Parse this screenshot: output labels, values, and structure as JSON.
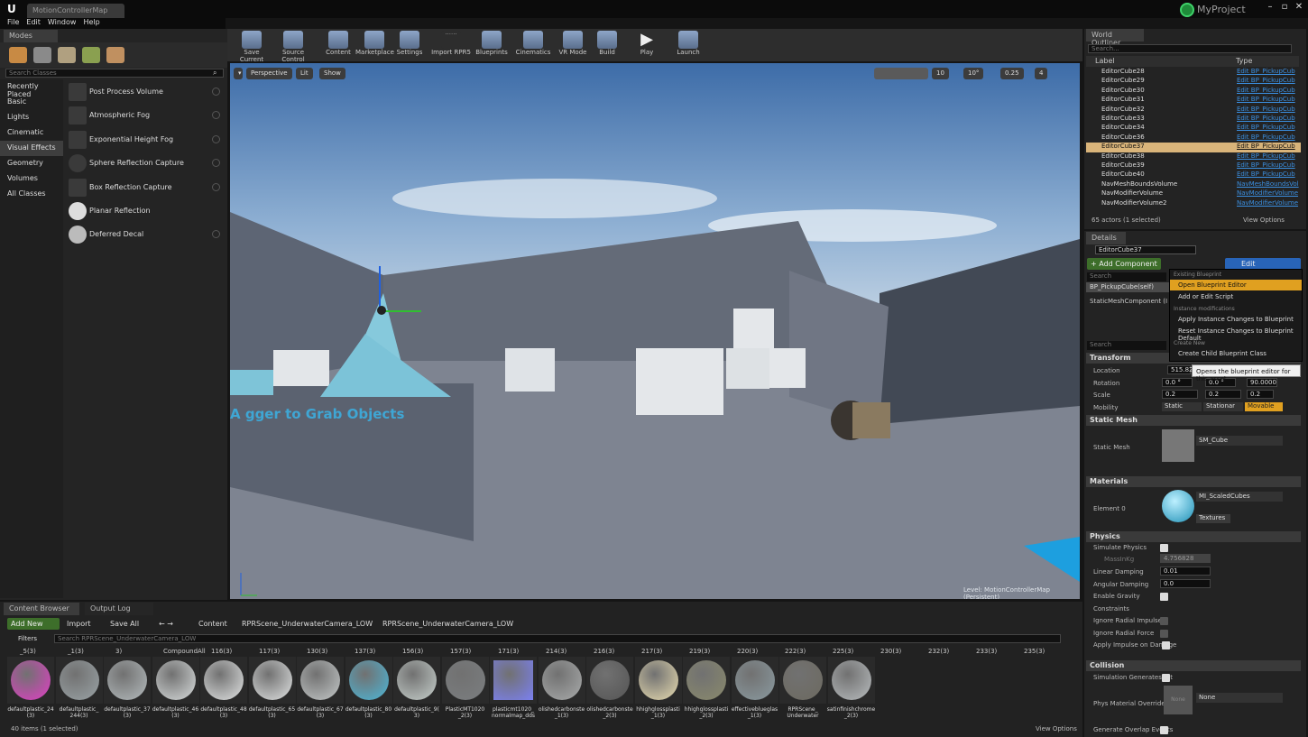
{
  "window": {
    "doc_tab": "MotionControllerMap",
    "project": "MyProject",
    "minimize": "–",
    "restore": "▫",
    "close": "✕"
  },
  "menu": [
    "File",
    "Edit",
    "Window",
    "Help"
  ],
  "modes": {
    "tab": "Modes",
    "search_placeholder": "Search Classes",
    "categories": [
      "Recently Placed",
      "Basic",
      "Lights",
      "Cinematic",
      "Visual Effects",
      "Geometry",
      "Volumes",
      "All Classes"
    ],
    "selected_category": "Visual Effects",
    "items": [
      "Post Process Volume",
      "Atmospheric Fog",
      "Exponential Height Fog",
      "Sphere Reflection Capture",
      "Box Reflection Capture",
      "Planar Reflection",
      "Deferred Decal"
    ]
  },
  "toolbar": [
    "Save Current",
    "Source Control",
    "Content",
    "Marketplace",
    "Settings",
    "Import RPR5",
    "Blueprints",
    "Cinematics",
    "VR Mode",
    "Build",
    "Play",
    "Launch"
  ],
  "viewport": {
    "perspective": "Perspective",
    "lit": "Lit",
    "show": "Show",
    "snap_grid": "10",
    "snap_rot": "10°",
    "snap_scale": "0.25",
    "cam_speed": "4",
    "in_world_text": "A  gger to Grab Objects",
    "level_label": "Level: MotionControllerMap (Persistent)"
  },
  "outliner": {
    "tab": "World Outliner",
    "search_placeholder": "Search...",
    "col_label": "Label",
    "col_type": "Type",
    "rows": [
      {
        "name": "EditorCube28",
        "type": "Edit BP_PickupCub"
      },
      {
        "name": "EditorCube29",
        "type": "Edit BP_PickupCub"
      },
      {
        "name": "EditorCube30",
        "type": "Edit BP_PickupCub"
      },
      {
        "name": "EditorCube31",
        "type": "Edit BP_PickupCub"
      },
      {
        "name": "EditorCube32",
        "type": "Edit BP_PickupCub"
      },
      {
        "name": "EditorCube33",
        "type": "Edit BP_PickupCub"
      },
      {
        "name": "EditorCube34",
        "type": "Edit BP_PickupCub"
      },
      {
        "name": "EditorCube36",
        "type": "Edit BP_PickupCub"
      },
      {
        "name": "EditorCube37",
        "type": "Edit BP_PickupCub"
      },
      {
        "name": "EditorCube38",
        "type": "Edit BP_PickupCub"
      },
      {
        "name": "EditorCube39",
        "type": "Edit BP_PickupCub"
      },
      {
        "name": "EditorCube40",
        "type": "Edit BP_PickupCub"
      },
      {
        "name": "NavMeshBoundsVolume",
        "type": "NavMeshBoundsVol"
      },
      {
        "name": "NavModifierVolume",
        "type": "NavModifierVolume"
      },
      {
        "name": "NavModifierVolume2",
        "type": "NavModifierVolume"
      }
    ],
    "selected": "EditorCube37",
    "count": "65 actors (1 selected)",
    "view_options": "View Options"
  },
  "details": {
    "tab": "Details",
    "name": "EditorCube37",
    "add_component": "+ Add Component",
    "edit_blueprint": "Edit Blueprint",
    "search_placeholder": "Search",
    "components": [
      "BP_PickupCube(self)",
      "StaticMeshComponent (I"
    ],
    "dropdown": {
      "h1": "Existing Blueprint",
      "open": "Open Blueprint Editor",
      "add_script": "Add or Edit Script",
      "h2": "Instance modifications",
      "apply": "Apply Instance Changes to Blueprint",
      "reset": "Reset Instance Changes to Blueprint Default",
      "h3": "Create New",
      "create_child": "Create Child Blueprint Class"
    },
    "tooltip": "Opens the blueprint editor for this asset",
    "transform": "Transform",
    "location": "Location",
    "location_x": "515.821",
    "rotation": "Rotation",
    "rot_x": "0.0 °",
    "rot_y": "0.0 °",
    "rot_z": "90.0000",
    "scale": "Scale",
    "scale_x": "0.2",
    "scale_y": "0.2",
    "scale_z": "0.2",
    "mobility": "Mobility",
    "mob_static": "Static",
    "mob_stationary": "Stationar",
    "mob_movable": "Movable",
    "static_mesh_sec": "Static Mesh",
    "static_mesh": "Static Mesh",
    "mesh_value": "SM_Cube",
    "materials_sec": "Materials",
    "element0": "Element 0",
    "mat_value": "MI_ScaledCubes",
    "textures": "Textures",
    "physics_sec": "Physics",
    "simulate": "Simulate Physics",
    "mass": "MassInKg",
    "mass_val": "4.756828",
    "linear": "Linear Damping",
    "linear_val": "0.01",
    "angular": "Angular Damping",
    "angular_val": "0.0",
    "gravity": "Enable Gravity",
    "constraints": "Constraints",
    "radial_impulse": "Ignore Radial Impulse",
    "radial_force": "Ignore Radial Force",
    "apply_impulse": "Apply Impulse on Damage",
    "collision_sec": "Collision",
    "sim_hit": "Simulation Generates Hit",
    "phys_mat": "Phys Material Override",
    "phys_none": "None",
    "phys_none2": "None",
    "overlap": "Generate Overlap Events"
  },
  "content_browser": {
    "tab1": "Content Browser",
    "tab2": "Output Log",
    "add_new": "Add New",
    "import": "Import",
    "save_all": "Save All",
    "path": [
      "Content",
      "RPRScene_UnderwaterCamera_LOW",
      "RPRScene_UnderwaterCamera_LOW"
    ],
    "filters": "Filters",
    "search_placeholder": "Search RPRScene_UnderwaterCamera_LOW",
    "col_nums": [
      "_5(3)",
      "_1(3)",
      "3)",
      "CompoundAll",
      "116(3)",
      "117(3)",
      "130(3)",
      "137(3)",
      "156(3)",
      "157(3)",
      "171(3)",
      "214(3)",
      "216(3)",
      "217(3)",
      "219(3)",
      "220(3)",
      "222(3)",
      "225(3)",
      "230(3)",
      "232(3)",
      "233(3)",
      "235(3)"
    ],
    "assets": [
      {
        "label": "defaultplastic_24 (3)",
        "color": "#e23ec6"
      },
      {
        "label": "defaultplastic_ 244(3)",
        "color": "#9aa3a6"
      },
      {
        "label": "defaultplastic_37 (3)",
        "color": "#b4bbbd"
      },
      {
        "label": "defaultplastic_46 (3)",
        "color": "#d8dcdc"
      },
      {
        "label": "defaultplastic_48 (3)",
        "color": "#e2e4e4"
      },
      {
        "label": "defaultplastic_65 (3)",
        "color": "#e0e2e2"
      },
      {
        "label": "defaultplastic_67 (3)",
        "color": "#c4c8c8"
      },
      {
        "label": "defaultplastic_80 (3)",
        "color": "#4cb7d8"
      },
      {
        "label": "defaultplastic_9( 3)",
        "color": "#c7d0cc"
      },
      {
        "label": "PlasticMT1020 _2(3)",
        "color": "#7b7e80"
      },
      {
        "label": "plasticmt1020_ normalmap_dds",
        "color": "#7b80f0"
      },
      {
        "label": "olishedcarbonste _1(3)",
        "color": "#a9abab"
      },
      {
        "label": "olishedcarbonste _2(3)",
        "color": "#555"
      },
      {
        "label": "hhighglossplasti _1(3)",
        "color": "#e8dcb0"
      },
      {
        "label": "hhighglossplasti _2(3)",
        "color": "#8a8a6c"
      },
      {
        "label": "effectiveblueglas _1(3)",
        "color": "#8a9aa0"
      },
      {
        "label": "RPRScene_ Underwater",
        "color": "#6d6a60"
      },
      {
        "label": "satinfinishchrome _2(3)",
        "color": "#b8bcbe"
      }
    ],
    "status": "40 items (1 selected)",
    "view_options": "View Options"
  }
}
